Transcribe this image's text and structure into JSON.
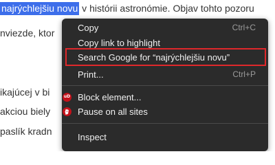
{
  "background": {
    "line1": {
      "selected": "najrýchlejšiu novu",
      "rest": " v histórii astronómie. Objav tohto pozoru"
    },
    "line2": "nviezde, ktor",
    "line3": "ikajúcej v bi",
    "line4": "akciou biely",
    "line5": "paslík kradn"
  },
  "context_menu": {
    "items": [
      {
        "label": "Copy",
        "shortcut": "Ctrl+C"
      },
      {
        "label": "Copy link to highlight",
        "shortcut": ""
      },
      {
        "label": "Search Google for “najrýchlejšiu novu”",
        "shortcut": ""
      },
      {
        "label": "Print...",
        "shortcut": "Ctrl+P"
      },
      {
        "label": "Block element...",
        "shortcut": ""
      },
      {
        "label": "Pause on all sites",
        "shortcut": ""
      },
      {
        "label": "Inspect",
        "shortcut": ""
      }
    ],
    "ublock_badge": "uD",
    "highlight_color": "#e0282b",
    "menu_bg": "#2b2b2b",
    "selection_color": "#3d6eea"
  }
}
